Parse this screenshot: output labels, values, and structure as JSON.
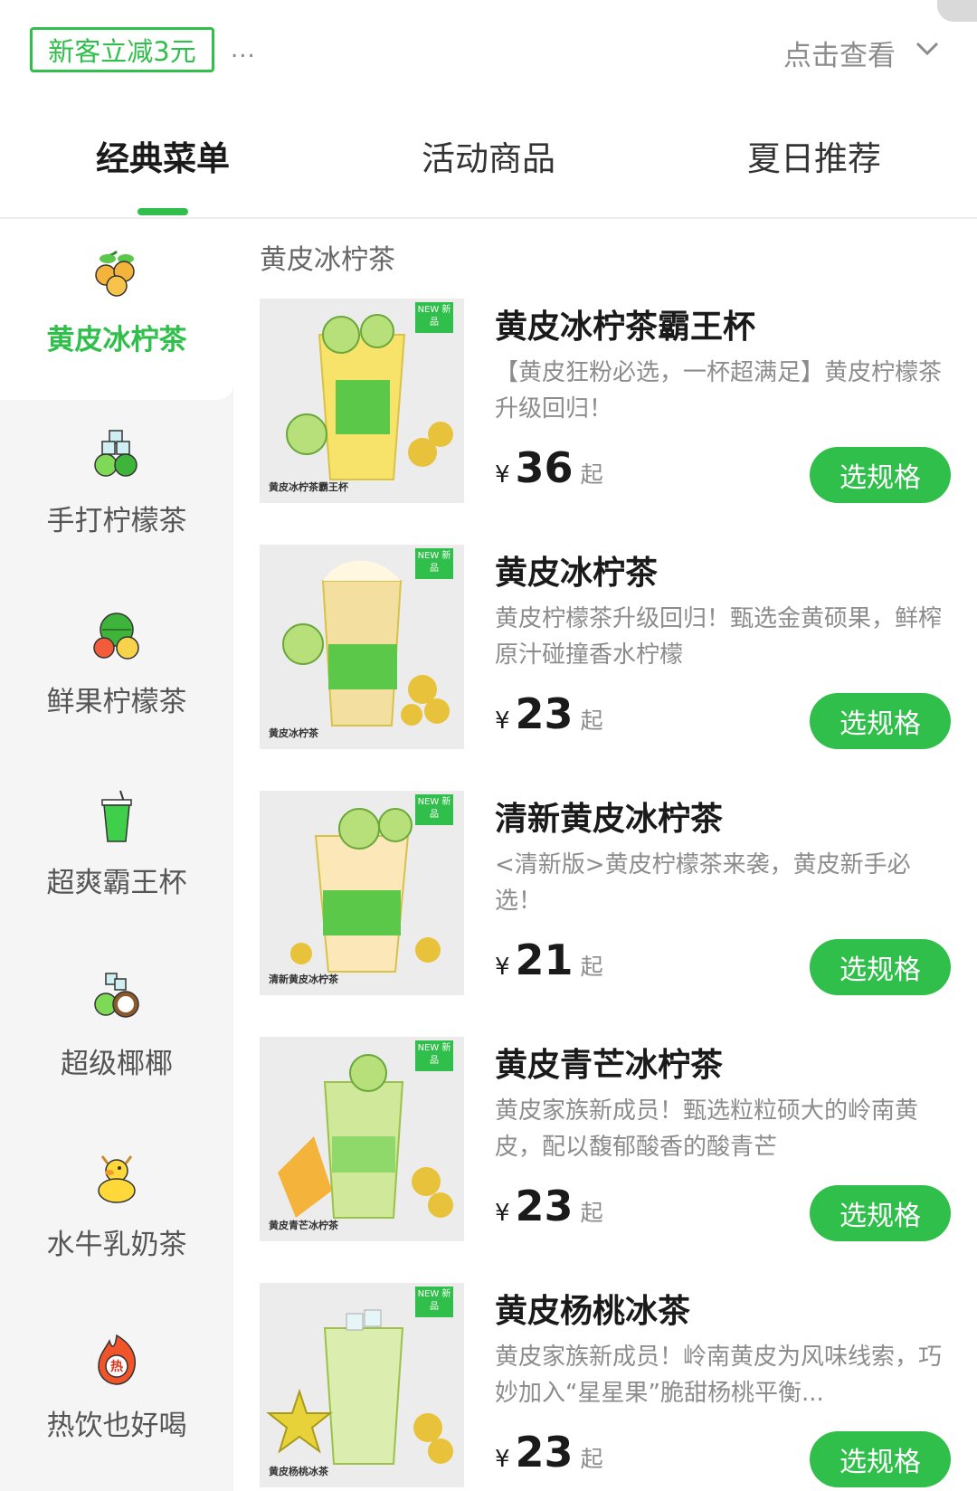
{
  "promo": {
    "tag": "新客立减3元",
    "dots": "...",
    "more": "点击查看"
  },
  "tabs": [
    {
      "label": "经典菜单",
      "active": true
    },
    {
      "label": "活动商品",
      "active": false
    },
    {
      "label": "夏日推荐",
      "active": false
    }
  ],
  "sidebar": {
    "items": [
      {
        "label": "黄皮冰柠茶",
        "icon": "yellow-fruit-icon",
        "active": true
      },
      {
        "label": "手打柠檬茶",
        "icon": "lemon-ice-icon",
        "active": false
      },
      {
        "label": "鲜果柠檬茶",
        "icon": "fruit-mix-icon",
        "active": false
      },
      {
        "label": "超爽霸王杯",
        "icon": "cup-icon",
        "active": false
      },
      {
        "label": "超级椰椰",
        "icon": "coconut-icon",
        "active": false
      },
      {
        "label": "水牛乳奶茶",
        "icon": "duck-icon",
        "active": false
      },
      {
        "label": "热饮也好喝",
        "icon": "hot-drink-icon",
        "active": false
      }
    ]
  },
  "section_title": "黄皮冰柠茶",
  "products": [
    {
      "name": "黄皮冰柠茶霸王杯",
      "desc": "【黄皮狂粉必选，一杯超满足】黄皮柠檬茶升级回归！",
      "currency": "¥",
      "price": "36",
      "suffix": "起",
      "button": "选规格",
      "badge": "NEW 新品",
      "cup_label": "黄皮冰柠茶霸王杯"
    },
    {
      "name": "黄皮冰柠茶",
      "desc": "黄皮柠檬茶升级回归！甄选金黄硕果，鲜榨原汁碰撞香水柠檬",
      "currency": "¥",
      "price": "23",
      "suffix": "起",
      "button": "选规格",
      "badge": "NEW 新品",
      "cup_label": "黄皮冰柠茶"
    },
    {
      "name": "清新黄皮冰柠茶",
      "desc": "<清新版>黄皮柠檬茶来袭，黄皮新手必选！",
      "currency": "¥",
      "price": "21",
      "suffix": "起",
      "button": "选规格",
      "badge": "NEW 新品",
      "cup_label": "清新黄皮冰柠茶"
    },
    {
      "name": "黄皮青芒冰柠茶",
      "desc": "黄皮家族新成员！甄选粒粒硕大的岭南黄皮，配以馥郁酸香的酸青芒",
      "currency": "¥",
      "price": "23",
      "suffix": "起",
      "button": "选规格",
      "badge": "NEW 新品",
      "cup_label": "黄皮青芒冰柠茶"
    },
    {
      "name": "黄皮杨桃冰茶",
      "desc": "黄皮家族新成员！岭南黄皮为风味线索，巧妙加入“星星果”脆甜杨桃平衡...",
      "currency": "¥",
      "price": "23",
      "suffix": "起",
      "button": "选规格",
      "badge": "NEW 新品",
      "cup_label": "黄皮杨桃冰茶"
    }
  ],
  "colors": {
    "accent": "#2fbf4a",
    "sidebar_bg": "#f5f5f5"
  }
}
